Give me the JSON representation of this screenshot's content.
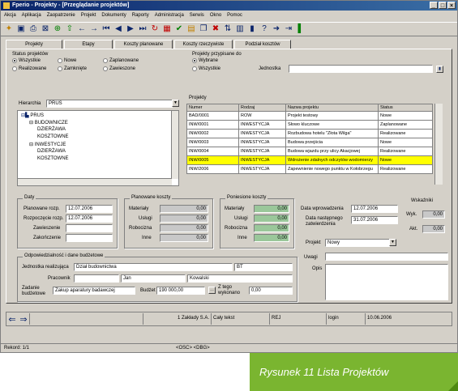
{
  "window": {
    "title": "Fperio - Projekty - [Przeglądanie projektów]"
  },
  "menu": [
    "Akcja",
    "Aplikacja",
    "Zaopatrzenie",
    "Projekt",
    "Dokumenty",
    "Raporty",
    "Administracja",
    "Serwis",
    "Okno",
    "Pomoc"
  ],
  "tabs": [
    "Projekty",
    "Etapy",
    "Koszty planowane",
    "Koszty rzeczywiste",
    "Podział kosztów"
  ],
  "status_projektow": {
    "title": "Status projektów",
    "options": [
      {
        "label": "Wszystkie",
        "on": true
      },
      {
        "label": "Nowe",
        "on": false
      },
      {
        "label": "Zaplanowane",
        "on": false
      },
      {
        "label": "Realizowane",
        "on": false
      },
      {
        "label": "Zamknięte",
        "on": false
      },
      {
        "label": "Zawieszone",
        "on": false
      }
    ]
  },
  "przypisane": {
    "title": "Projekty przypisane do",
    "options": [
      {
        "label": "Wybrane",
        "on": true
      },
      {
        "label": "Wszystkie",
        "on": false
      }
    ],
    "jednostka_label": "Jednostka",
    "jednostka_value": ""
  },
  "hierarchia": {
    "label": "Hierarchia",
    "value": "PRUS"
  },
  "tree": [
    "PRUS",
    "BUDOWNICZE",
    "DZIERŻAWA",
    "KOSZTOWNE",
    "INWESTYCJE",
    "DZIERŻAWA",
    "KOSZTOWNE"
  ],
  "projekty": {
    "title": "Projekty",
    "columns": [
      "Numer",
      "Rodzaj",
      "Nazwa projektu",
      "Status"
    ],
    "rows": [
      {
        "numer": "BAD/0001",
        "rodzaj": "ROW",
        "nazwa": "Projekt testowy",
        "status": "Nowe",
        "hl": false
      },
      {
        "numer": "INW/0001",
        "rodzaj": "INWESTYCJA",
        "nazwa": "Słowo kluczowe",
        "status": "Zaplanowane",
        "hl": false
      },
      {
        "numer": "INW/0002",
        "rodzaj": "INWESTYCJA",
        "nazwa": "Rozbudowa hotelu \"Złota Wilga\"",
        "status": "Realizowane",
        "hl": false
      },
      {
        "numer": "INW/0003",
        "rodzaj": "INWESTYCJA",
        "nazwa": "Budowa przejścia",
        "status": "Nowe",
        "hl": false
      },
      {
        "numer": "INW/0004",
        "rodzaj": "INWESTYCJA",
        "nazwa": "Budowa wjazdu przy ulicy Akacjowej",
        "status": "Realizowane",
        "hl": false
      },
      {
        "numer": "INW/0005",
        "rodzaj": "INWESTYCJA",
        "nazwa": "Wdrożenie zdalnych odczytów wodomierzy",
        "status": "Nowe",
        "hl": true
      },
      {
        "numer": "INW/2006",
        "rodzaj": "INWESTYCJA",
        "nazwa": "Zapewnienie nowego punktu w Kołobrzegu",
        "status": "Realizowane",
        "hl": false
      }
    ]
  },
  "daty": {
    "title": "Daty",
    "rows": [
      {
        "label": "Planowane rozp.",
        "value": "12.07.2006"
      },
      {
        "label": "Rozpoczęcie rozp.",
        "value": "12.07.2006"
      },
      {
        "label": "Zawieszenie",
        "value": ""
      },
      {
        "label": "Zakończenie",
        "value": ""
      }
    ]
  },
  "planowane": {
    "title": "Planowane koszty",
    "rows": [
      {
        "label": "Materiały",
        "value": "0,00"
      },
      {
        "label": "Usługi",
        "value": "0,00"
      },
      {
        "label": "Robocizna",
        "value": "0,00"
      },
      {
        "label": "Inne",
        "value": "0,00"
      }
    ]
  },
  "poniesione": {
    "title": "Poniesione koszty",
    "rows": [
      {
        "label": "Materiały",
        "value": "0,00"
      },
      {
        "label": "Usługi",
        "value": "0,00"
      },
      {
        "label": "Robocizna",
        "value": "0,00"
      },
      {
        "label": "Inne",
        "value": "0,00"
      }
    ]
  },
  "wprowadzenie": {
    "data_label": "Data wprowadzenia",
    "data_value": "12.07.2006",
    "nast_label": "Data następnego zatwierdzenia",
    "nast_value": "31.07.2006",
    "projekt_label": "Projekt",
    "projekt_value": "Nowy"
  },
  "wskazniki": {
    "title": "Wskaźniki",
    "rows": [
      {
        "label": "Wyk.",
        "value": "0,00"
      },
      {
        "label": "Akt.",
        "value": "0,00"
      }
    ]
  },
  "uwagi": {
    "uwagi_label": "Uwagi",
    "opis_label": "Opis"
  },
  "odpowiedzialnosc": {
    "title": "Odpowiedzialność i dane budżetowe",
    "jednostka_label": "Jednostka realizująca",
    "jednostka_value": "Dział budownictwa",
    "jednostka_code": "BT",
    "pracownik_label": "Pracownik",
    "pracownik_value": "",
    "pracownik_imie": "Jan",
    "pracownik_nazwisko": "Kowalski",
    "zadanie_label": "Zadanie budżetowe",
    "zadanie_value": "Zakup aparatury badawczej",
    "budzet_label": "Budżet",
    "budzet_value": "190 000,00",
    "zbieg_label": "Z tego wykonano",
    "zbieg_value": "0,00"
  },
  "nav_cells": [
    "",
    "1 Zakłady S.A.",
    "Cały tekst",
    "REJ",
    "login",
    "10.06.2006"
  ],
  "status": {
    "rekord": "Rekord: 1/1",
    "mode": "<OSC> <DBG>"
  },
  "caption": "Rysunek 11 Lista Projektów",
  "colors": {
    "title_bar": "#0a246a",
    "highlight": "#ffff00",
    "caption_bg": "#7ab530"
  }
}
